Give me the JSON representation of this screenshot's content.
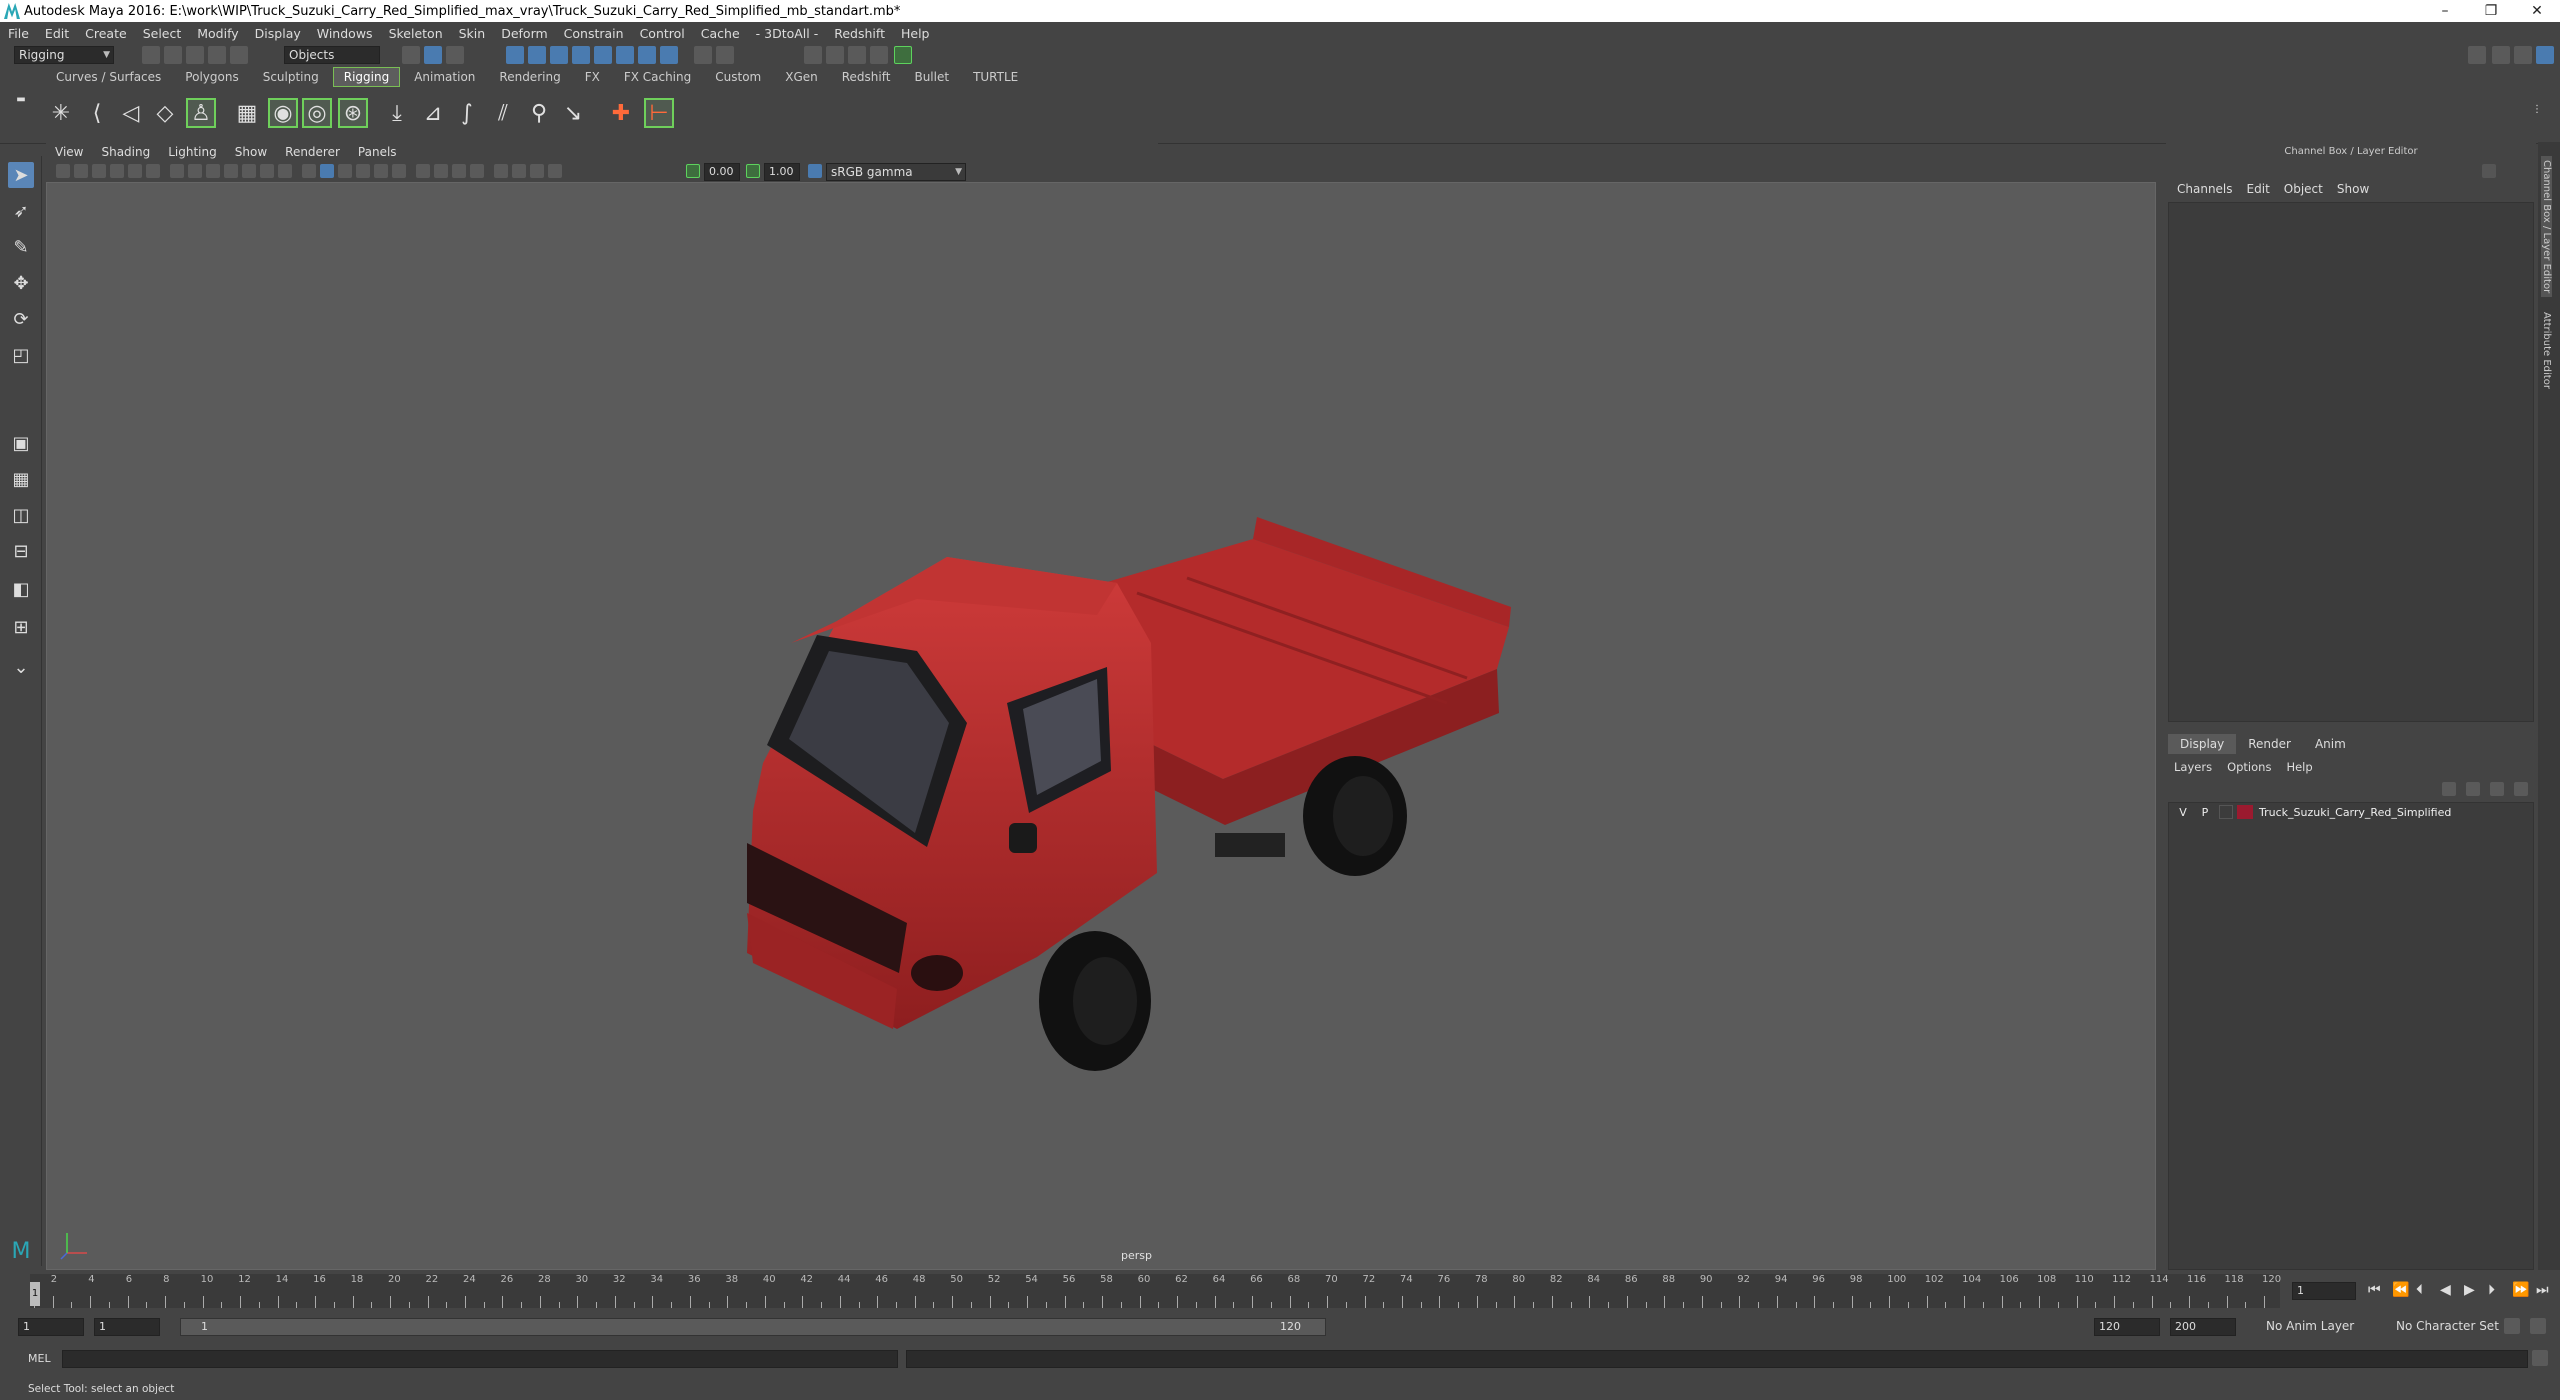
{
  "window": {
    "title": "Autodesk Maya 2016: E:\\work\\WIP\\Truck_Suzuki_Carry_Red_Simplified_max_vray\\Truck_Suzuki_Carry_Red_Simplified_mb_standart.mb*",
    "minimize": "–",
    "maximize": "❐",
    "close": "✕"
  },
  "menubar": [
    "File",
    "Edit",
    "Create",
    "Select",
    "Modify",
    "Display",
    "Windows",
    "Skeleton",
    "Skin",
    "Deform",
    "Constrain",
    "Control",
    "Cache",
    "- 3DtoAll -",
    "Redshift",
    "Help"
  ],
  "statusline": {
    "menuset": "Rigging",
    "selection_mode": "Objects"
  },
  "shelf_tabs": {
    "tabs": [
      "Curves / Surfaces",
      "Polygons",
      "Sculpting",
      "Rigging",
      "Animation",
      "Rendering",
      "FX",
      "FX Caching",
      "Custom",
      "XGen",
      "Redshift",
      "Bullet",
      "TURTLE"
    ],
    "active": "Rigging"
  },
  "viewport": {
    "menu": [
      "View",
      "Shading",
      "Lighting",
      "Show",
      "Renderer",
      "Panels"
    ],
    "exposure": "0.00",
    "gamma": "1.00",
    "color_space": "sRGB gamma",
    "camera_label": "persp"
  },
  "channel_box": {
    "title": "Channel Box / Layer Editor",
    "menu": [
      "Channels",
      "Edit",
      "Object",
      "Show"
    ]
  },
  "layer_editor": {
    "tabs": [
      "Display",
      "Render",
      "Anim"
    ],
    "active_tab": "Display",
    "menu": [
      "Layers",
      "Options",
      "Help"
    ],
    "layers": [
      {
        "visible": "V",
        "playback": "P",
        "name": "Truck_Suzuki_Carry_Red_Simplified",
        "color": "#9b1a2f"
      }
    ]
  },
  "side_tabs": [
    "Channel Box / Layer Editor",
    "Attribute Editor"
  ],
  "timeline": {
    "labels": [
      "2",
      "4",
      "6",
      "8",
      "10",
      "12",
      "14",
      "16",
      "18",
      "20",
      "22",
      "24",
      "26",
      "28",
      "30",
      "32",
      "34",
      "36",
      "38",
      "40",
      "42",
      "44",
      "46",
      "48",
      "50",
      "52",
      "54",
      "56",
      "58",
      "60",
      "62",
      "64",
      "66",
      "68",
      "70",
      "72",
      "74",
      "76",
      "78",
      "80",
      "82",
      "84",
      "86",
      "88",
      "90",
      "92",
      "94",
      "96",
      "98",
      "100",
      "102",
      "104",
      "106",
      "108",
      "110",
      "112",
      "114",
      "116",
      "118",
      "120"
    ],
    "current_frame_marker": "1",
    "current_frame": "1"
  },
  "range": {
    "start": "1",
    "playback_start": "1",
    "slider_start": "1",
    "slider_end": "120",
    "playback_end": "120",
    "end": "200",
    "anim_layer": "No Anim Layer",
    "character_set": "No Character Set"
  },
  "command_line": {
    "language": "MEL"
  },
  "help_line": "Select Tool: select an object",
  "colors": {
    "accent_green": "#6fd05b",
    "accent_blue": "#5a86b8",
    "truck_red": "#b3282a"
  }
}
